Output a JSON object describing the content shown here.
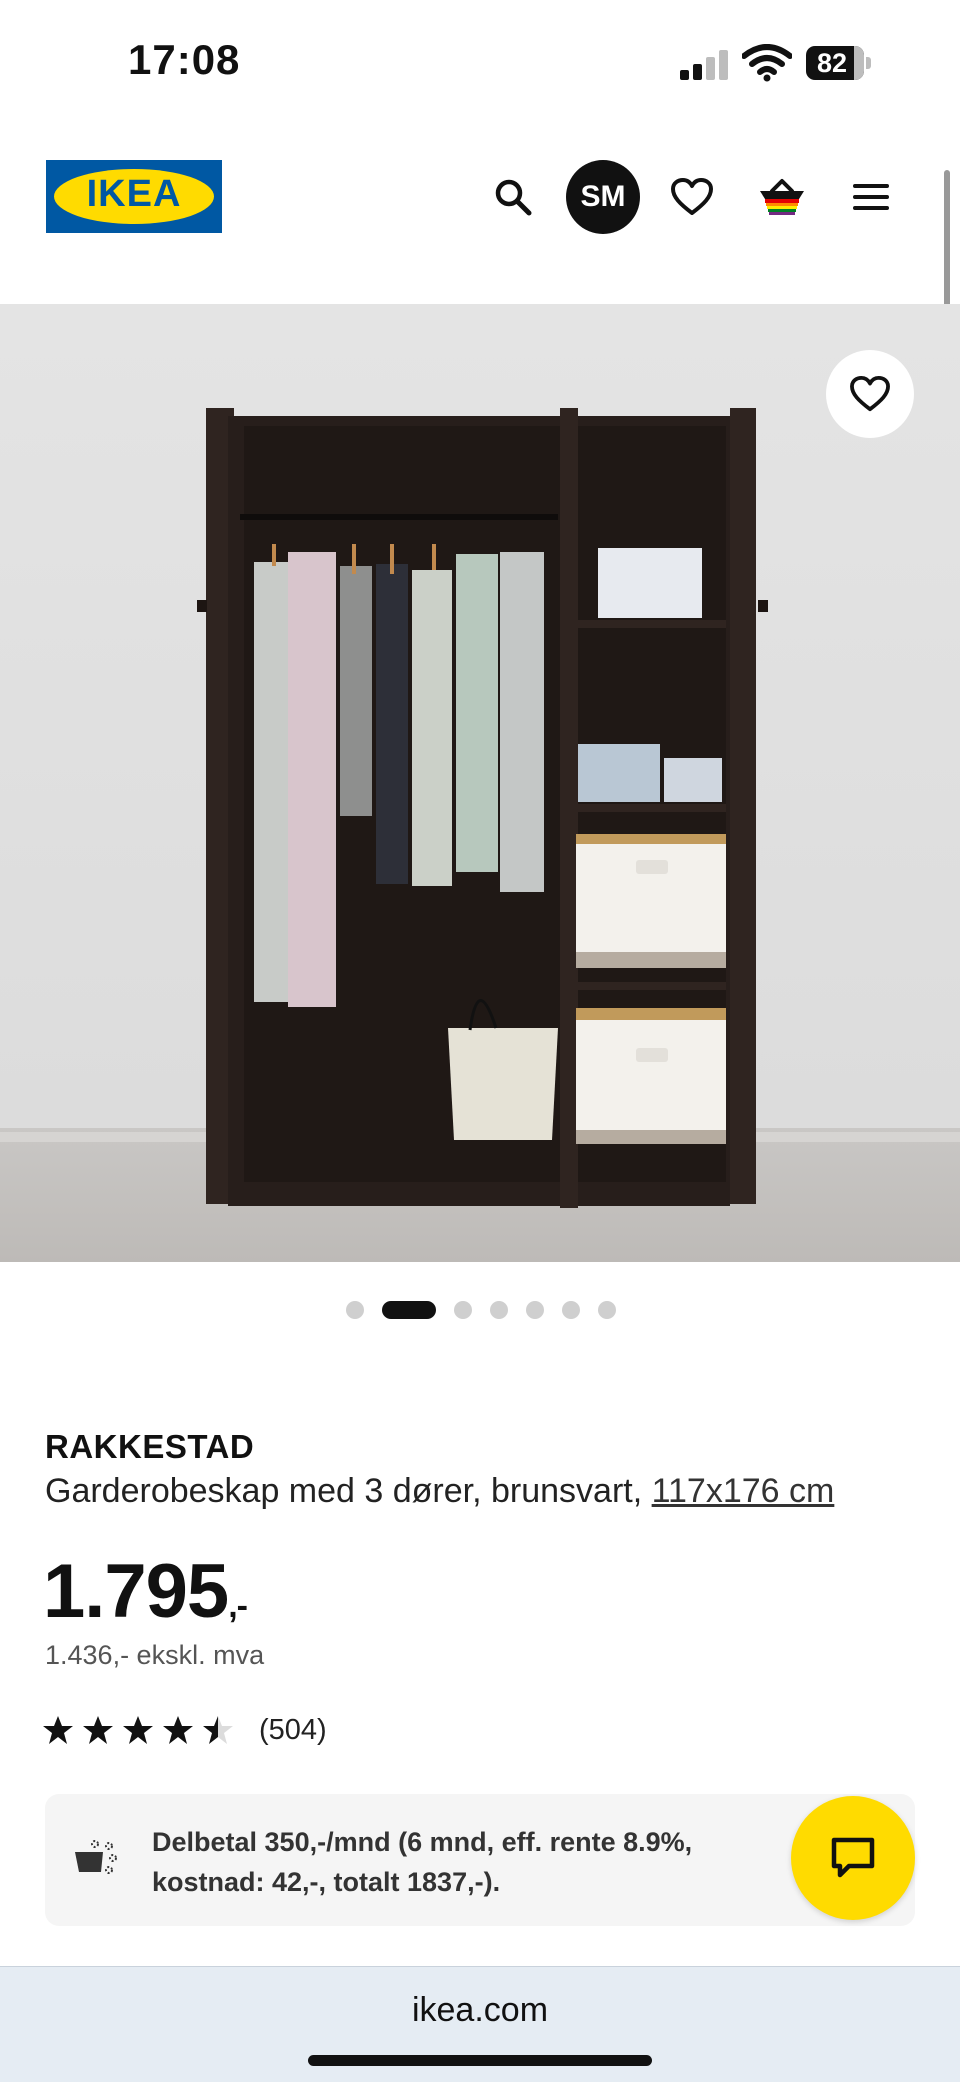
{
  "status_bar": {
    "time": "17:08",
    "battery": "82"
  },
  "header": {
    "logo": "IKEA",
    "avatar_initials": "SM",
    "icons": [
      "search-icon",
      "heart-icon",
      "basket-icon",
      "menu-icon"
    ]
  },
  "carousel": {
    "slide_count": 7,
    "active_index": 1
  },
  "product": {
    "name": "RAKKESTAD",
    "description": "Garderobeskap med 3 dører, brunsvart, ",
    "size_link": "117x176 cm",
    "price_main": "1.795",
    "price_suffix": ",-",
    "price_ex_vat": "1.436,- ekskl. mva",
    "rating_value": 4.5,
    "rating_count": "(504)"
  },
  "finance": {
    "text": "Delbetal 350,-/mnd (6 mnd, eff. rente 8.9%, kostnad: 42,-, totalt 1837,-)."
  },
  "browser": {
    "url": "ikea.com"
  },
  "colors": {
    "ikea_blue": "#0058a3",
    "ikea_yellow": "#ffdb00"
  }
}
